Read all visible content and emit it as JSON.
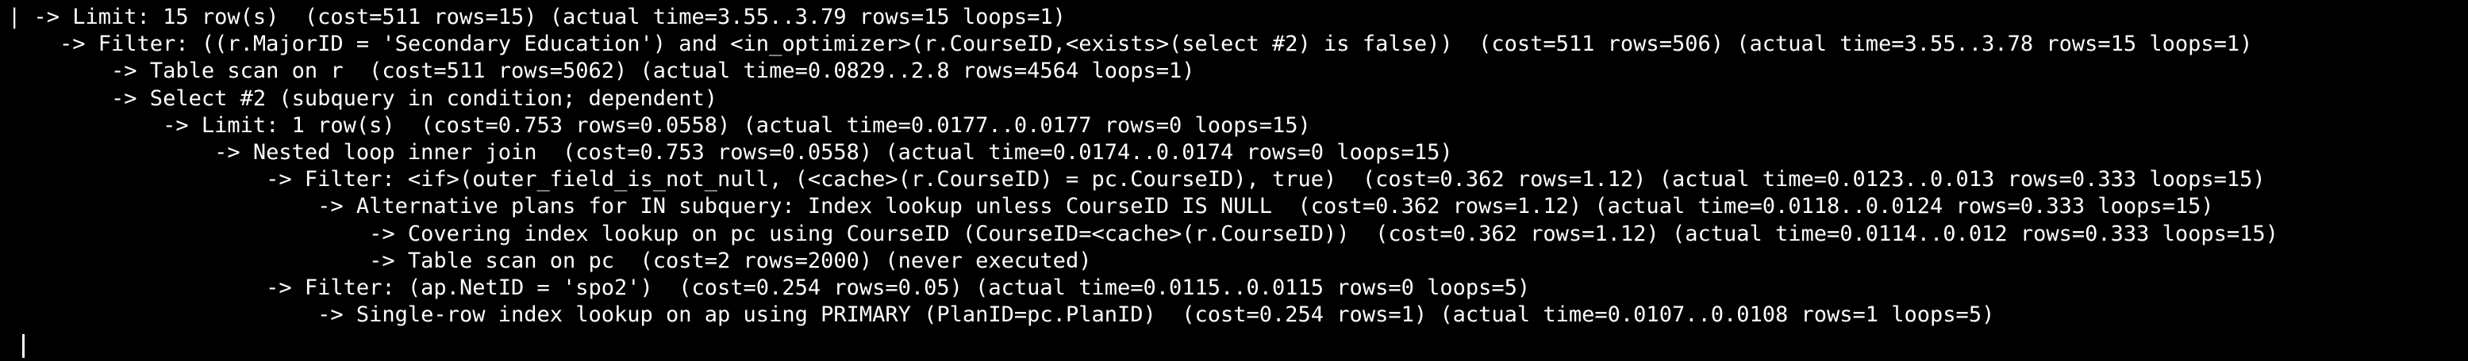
{
  "terminal": {
    "lines": [
      "| -> Limit: 15 row(s)  (cost=511 rows=15) (actual time=3.55..3.79 rows=15 loops=1)",
      "    -> Filter: ((r.MajorID = 'Secondary Education') and <in_optimizer>(r.CourseID,<exists>(select #2) is false))  (cost=511 rows=506) (actual time=3.55..3.78 rows=15 loops=1)",
      "        -> Table scan on r  (cost=511 rows=5062) (actual time=0.0829..2.8 rows=4564 loops=1)",
      "        -> Select #2 (subquery in condition; dependent)",
      "            -> Limit: 1 row(s)  (cost=0.753 rows=0.0558) (actual time=0.0177..0.0177 rows=0 loops=15)",
      "                -> Nested loop inner join  (cost=0.753 rows=0.0558) (actual time=0.0174..0.0174 rows=0 loops=15)",
      "                    -> Filter: <if>(outer_field_is_not_null, (<cache>(r.CourseID) = pc.CourseID), true)  (cost=0.362 rows=1.12) (actual time=0.0123..0.013 rows=0.333 loops=15)",
      "                        -> Alternative plans for IN subquery: Index lookup unless CourseID IS NULL  (cost=0.362 rows=1.12) (actual time=0.0118..0.0124 rows=0.333 loops=15)",
      "                            -> Covering index lookup on pc using CourseID (CourseID=<cache>(r.CourseID))  (cost=0.362 rows=1.12) (actual time=0.0114..0.012 rows=0.333 loops=15)",
      "                            -> Table scan on pc  (cost=2 rows=2000) (never executed)",
      "                    -> Filter: (ap.NetID = 'spo2')  (cost=0.254 rows=0.05) (actual time=0.0115..0.0115 rows=0 loops=5)",
      "                        -> Single-row index lookup on ap using PRIMARY (PlanID=pc.PlanID)  (cost=0.254 rows=1) (actual time=0.0107..0.0108 rows=1 loops=5)"
    ]
  }
}
